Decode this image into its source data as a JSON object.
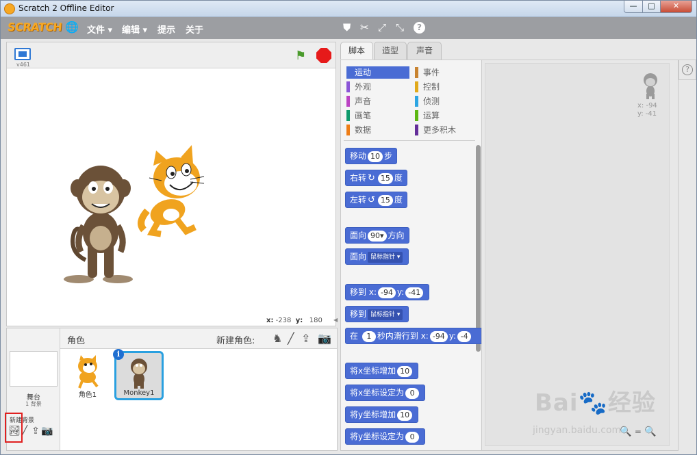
{
  "window": {
    "title": "Scratch 2 Offline Editor",
    "min": "—",
    "max": "□",
    "close": "✕"
  },
  "menubar": {
    "logo": "SCRATCH",
    "file": "文件 ▾",
    "edit": "编辑 ▾",
    "tips": "提示",
    "about": "关于",
    "tools": [
      "stamp-icon",
      "cut-icon",
      "grow-icon",
      "shrink-icon",
      "help-icon"
    ]
  },
  "stage": {
    "version": "v461",
    "coords_x_label": "x:",
    "coords_x": "-238",
    "coords_y_label": "y:",
    "coords_y": "180"
  },
  "sprites": {
    "title": "角色",
    "new_sprite_label": "新建角色:",
    "stage_label": "舞台",
    "bg_count": "1 背景",
    "new_bg_label": "新建背景",
    "items": [
      {
        "name": "角色1"
      },
      {
        "name": "Monkey1"
      }
    ]
  },
  "tabs": [
    "脚本",
    "造型",
    "声音"
  ],
  "categories": [
    {
      "label": "运动",
      "color": "#4a6cd4"
    },
    {
      "label": "事件",
      "color": "#c88330"
    },
    {
      "label": "外观",
      "color": "#8a55d7"
    },
    {
      "label": "控制",
      "color": "#e1a91a"
    },
    {
      "label": "声音",
      "color": "#bb42c3"
    },
    {
      "label": "侦测",
      "color": "#2ca5e2"
    },
    {
      "label": "画笔",
      "color": "#0e9a6c"
    },
    {
      "label": "运算",
      "color": "#5cb712"
    },
    {
      "label": "数据",
      "color": "#ee7d16"
    },
    {
      "label": "更多积木",
      "color": "#632d99"
    }
  ],
  "blocks": {
    "move": {
      "pre": "移动",
      "val": "10",
      "post": "步"
    },
    "turn_right": {
      "pre": "右转",
      "val": "15",
      "post": "度"
    },
    "turn_left": {
      "pre": "左转",
      "val": "15",
      "post": "度"
    },
    "point_dir": {
      "pre": "面向",
      "val": "90▾",
      "post": "方向"
    },
    "point_towards": {
      "pre": "面向",
      "dd": "鼠标指针 ▾"
    },
    "goto_xy": {
      "pre": "移到",
      "xl": "x:",
      "x": "-94",
      "yl": "y:",
      "y": "-41"
    },
    "goto": {
      "pre": "移到",
      "dd": "鼠标指针 ▾"
    },
    "glide": {
      "pre": "在",
      "secs": "1",
      "mid": "秒内滑行到",
      "xl": "x:",
      "x": "-94",
      "yl": "y:",
      "y": "-4"
    },
    "change_x": {
      "pre": "将x坐标增加",
      "val": "10"
    },
    "set_x": {
      "pre": "将x坐标设定为",
      "val": "0"
    },
    "change_y": {
      "pre": "将y坐标增加",
      "val": "10"
    },
    "set_y": {
      "pre": "将y坐标设定为",
      "val": "0"
    }
  },
  "script_area": {
    "sprite_x": "x: -94",
    "sprite_y": "y: -41",
    "help": "?"
  },
  "watermark": {
    "text": "Bai🐾经验",
    "url": "jingyan.baidu.com"
  }
}
